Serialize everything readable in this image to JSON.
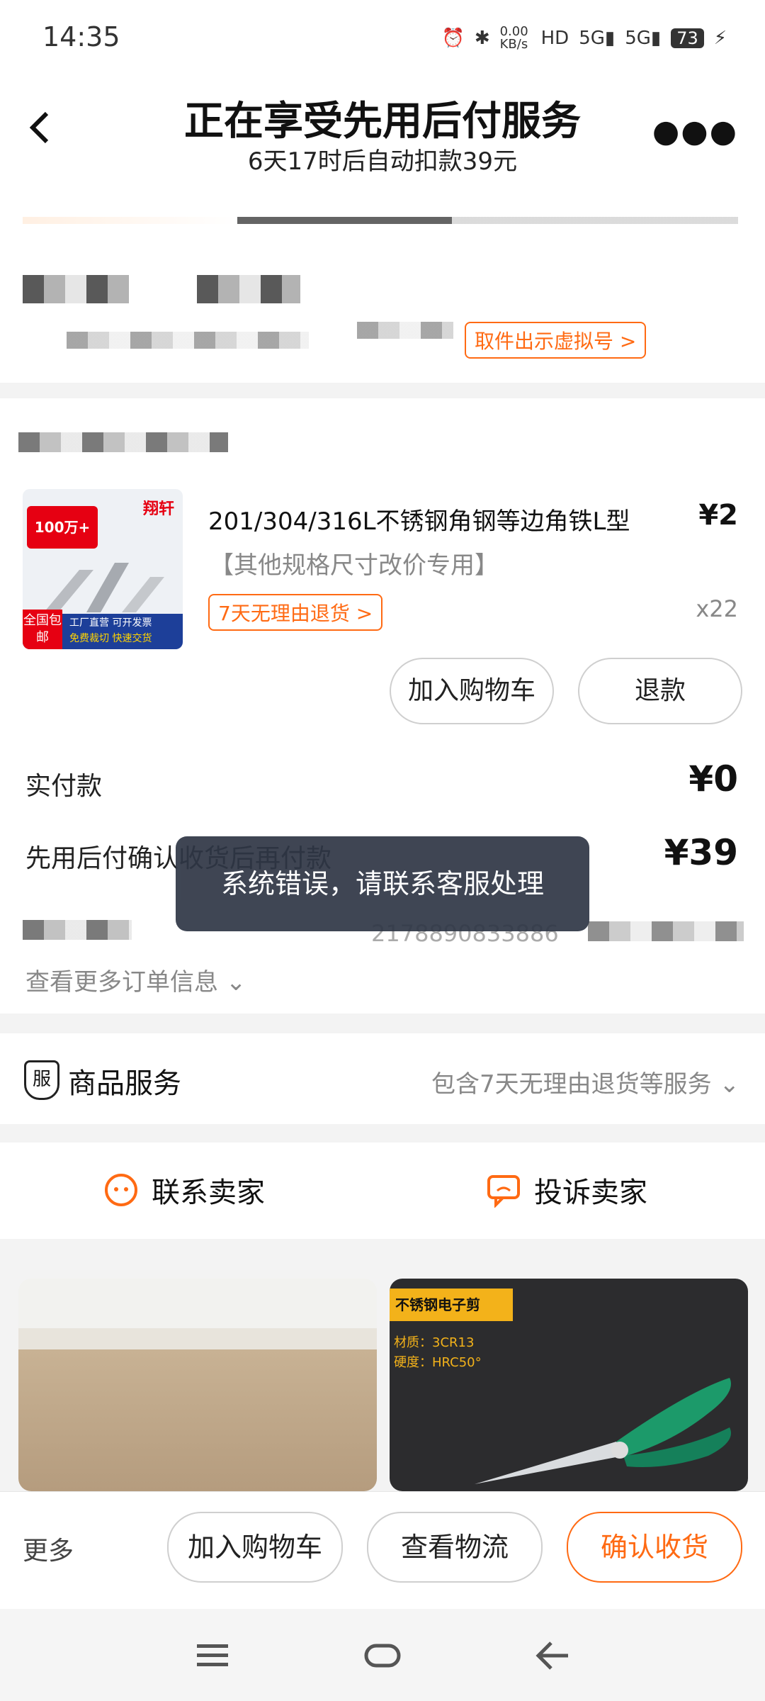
{
  "status_bar": {
    "time": "14:35",
    "net_speed": "0.00 KB/s",
    "battery": "73"
  },
  "header": {
    "title": "正在享受先用后付服务",
    "subtitle": "6天17时后自动扣款39元"
  },
  "address": {
    "virtual_number_button": "取件出示虚拟号 >"
  },
  "order": {
    "product_title": "201/304/316L不锈钢角钢等边角铁L型",
    "product_spec": "【其他规格尺寸改价专用】",
    "price": "¥2",
    "quantity": "x22",
    "return_tag": "7天无理由退货 >",
    "add_cart_button": "加入购物车",
    "refund_button": "退款",
    "paid_label": "实付款",
    "paid_value": "¥0",
    "bnpl_label": "先用后付确认收货后再付款",
    "bnpl_value": "¥39",
    "order_number": "2178890833886",
    "view_more": "查看更多订单信息"
  },
  "toast": "系统错误，请联系客服处理",
  "service": {
    "label": "商品服务",
    "badge": "服",
    "detail": "包含7天无理由退货等服务"
  },
  "contact": {
    "seller_label": "联系卖家",
    "complain_label": "投诉卖家"
  },
  "recommend": {
    "right_tag": "不锈钢电子剪",
    "right_material": "材质：3CR13",
    "right_hardness": "硬度：HRC50°"
  },
  "product_image": {
    "sales_badge": "100万+",
    "brand": "翔轩",
    "free_shipping": "全国包邮",
    "factory_text": "工厂直营 可开发票",
    "cutting_text": "免费裁切 快速交货"
  },
  "bottom_bar": {
    "more": "更多",
    "add_cart": "加入购物车",
    "logistics": "查看物流",
    "confirm": "确认收货"
  },
  "colors": {
    "accent": "#ff6a13",
    "toast_bg": "#2f3645"
  }
}
